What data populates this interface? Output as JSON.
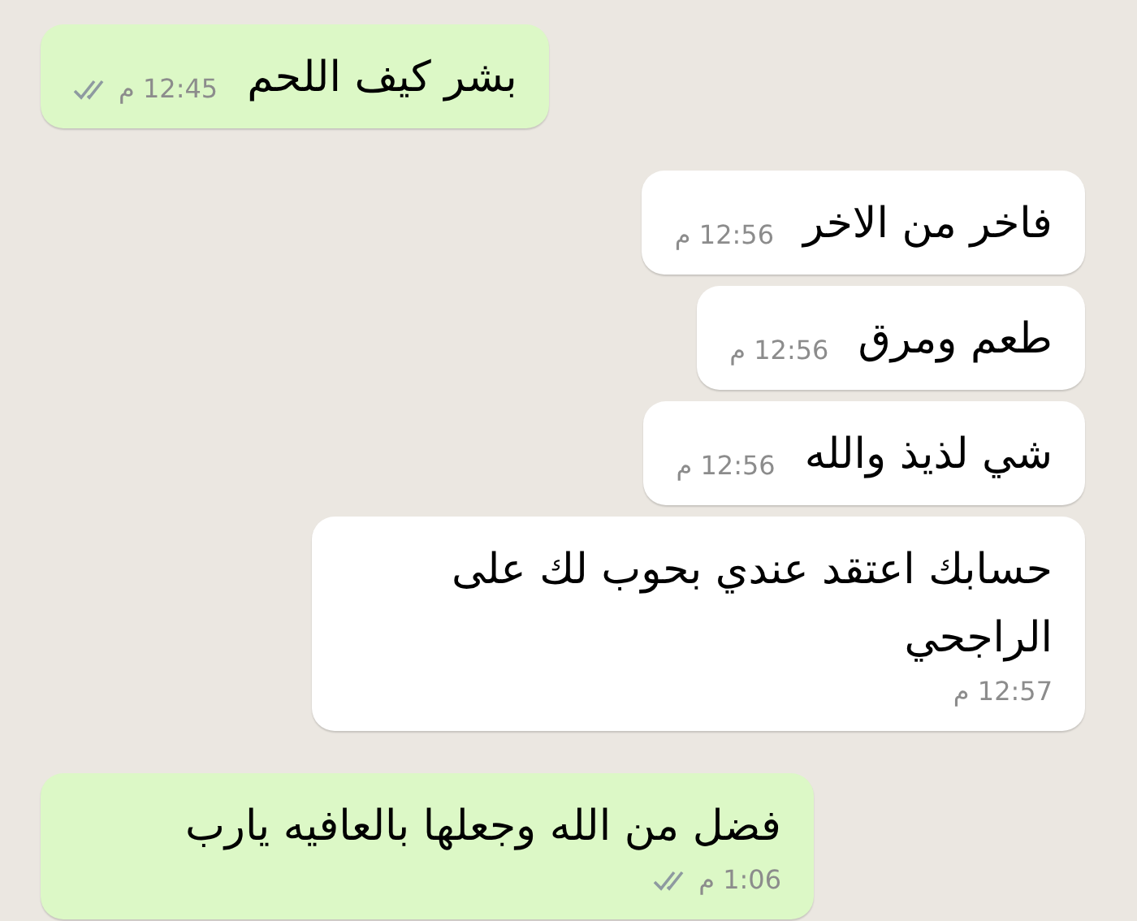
{
  "messages": [
    {
      "outgoing": true,
      "text": "بشر كيف اللحم",
      "time": "12:45 م",
      "delivered": true
    },
    {
      "outgoing": false,
      "text": "فاخر من الاخر",
      "time": "12:56 م"
    },
    {
      "outgoing": false,
      "text": "طعم ومرق",
      "time": "12:56 م"
    },
    {
      "outgoing": false,
      "text": "شي لذيذ والله",
      "time": "12:56 م"
    },
    {
      "outgoing": false,
      "text": "حسابك اعتقد عندي بحوب لك على الراجحي",
      "time": "12:57 م"
    },
    {
      "outgoing": true,
      "text": "فضل من الله وجعلها بالعافيه يارب",
      "time": "1:06 م",
      "delivered": true
    }
  ]
}
